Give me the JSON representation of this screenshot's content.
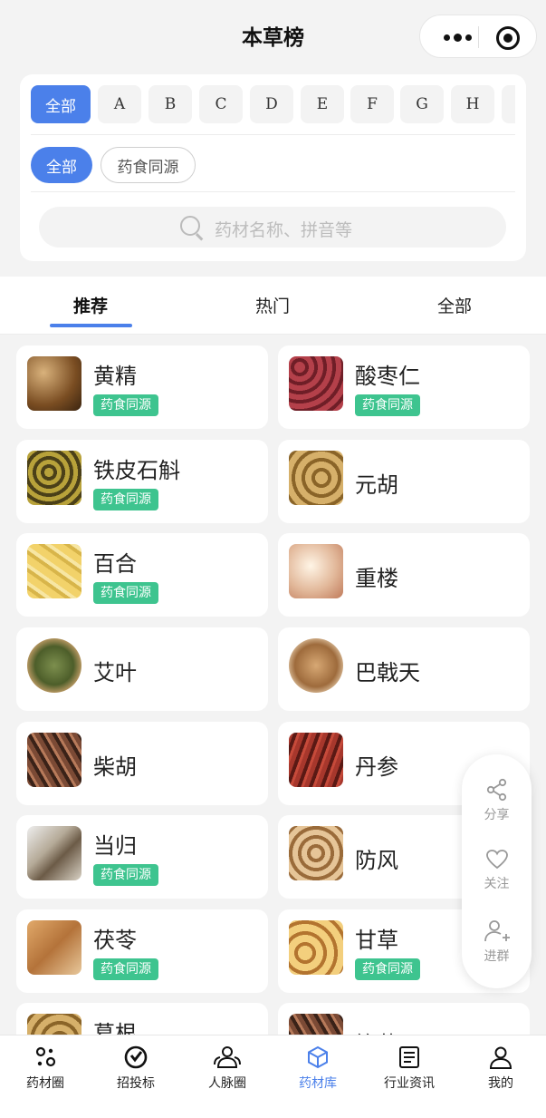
{
  "header": {
    "title": "本草榜"
  },
  "filters": {
    "letters": [
      "全部",
      "A",
      "B",
      "C",
      "D",
      "E",
      "F",
      "G",
      "H"
    ],
    "chips": [
      "全部",
      "药食同源"
    ],
    "search_placeholder": "药材名称、拼音等"
  },
  "tabs": [
    "推荐",
    "热门",
    "全部"
  ],
  "items": [
    {
      "name": "黄精",
      "tag": "药食同源"
    },
    {
      "name": "酸枣仁",
      "tag": "药食同源"
    },
    {
      "name": "铁皮石斛",
      "tag": "药食同源"
    },
    {
      "name": "元胡",
      "tag": ""
    },
    {
      "name": "百合",
      "tag": "药食同源"
    },
    {
      "name": "重楼",
      "tag": ""
    },
    {
      "name": "艾叶",
      "tag": ""
    },
    {
      "name": "巴戟天",
      "tag": ""
    },
    {
      "name": "柴胡",
      "tag": ""
    },
    {
      "name": "丹参",
      "tag": ""
    },
    {
      "name": "当归",
      "tag": "药食同源"
    },
    {
      "name": "防风",
      "tag": ""
    },
    {
      "name": "茯苓",
      "tag": "药食同源"
    },
    {
      "name": "甘草",
      "tag": "药食同源"
    },
    {
      "name": "葛根",
      "tag": ""
    },
    {
      "name": "钩藤",
      "tag": ""
    }
  ],
  "float_actions": [
    "分享",
    "关注",
    "进群"
  ],
  "bottom_nav": [
    "药材圈",
    "招投标",
    "人脉圈",
    "药材库",
    "行业资讯",
    "我的"
  ],
  "colors": {
    "primary": "#4b80ea",
    "tag_green": "#3ec48f"
  }
}
